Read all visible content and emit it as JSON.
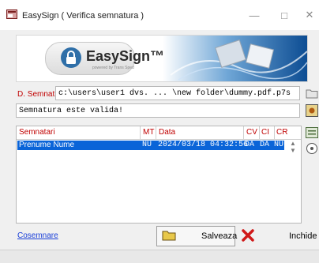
{
  "window": {
    "title": "EasySign ( Verifica semnatura )",
    "min": "—",
    "max": "□",
    "close": "✕"
  },
  "banner": {
    "logo_text": "EasySign™",
    "logo_sub": "powered by Trans Sped"
  },
  "file": {
    "label": "D. Semnat",
    "path": "c:\\users\\user1 dvs. ... \\new folder\\dummy.pdf.p7s"
  },
  "status": {
    "text": "Semnatura este valida!"
  },
  "table": {
    "headers": [
      "Semnatari",
      "MT",
      "Data",
      "CV",
      "CI",
      "CR"
    ],
    "rows": [
      {
        "name": "Prenume Nume",
        "mt": "NU",
        "date": "2024/03/18 04:32:56",
        "cv": "DA",
        "ci": "DA",
        "cr": "NU"
      }
    ]
  },
  "actions": {
    "cosemnare": "Cosemnare",
    "save": "Salveaza",
    "close": "Inchide"
  },
  "colors": {
    "accent": "#0a64d8",
    "label_red": "#c00000",
    "link": "#1a3fd8"
  }
}
